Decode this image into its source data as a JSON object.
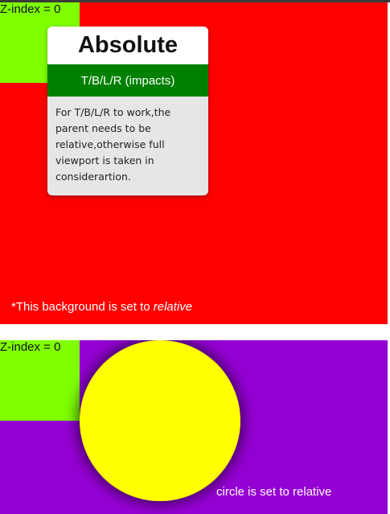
{
  "red_section": {
    "zindex_label": "Z-index = 0",
    "card": {
      "title": "Absolute",
      "subtitle": "T/B/L/R (impacts)",
      "body": "For T/B/L/R to work,the parent needs to be relative,otherwise full viewport is taken in considerartion."
    },
    "note_prefix": "*This background is set to ",
    "note_emphasis": "relative"
  },
  "purple_section": {
    "zindex_label": "Z-index = 0",
    "circle_note": "circle is set to relative"
  },
  "colors": {
    "red": "#ff0000",
    "purple": "#9400d3",
    "green_box": "#7fff00",
    "card_header": "#008000",
    "circle": "#ffff00"
  }
}
